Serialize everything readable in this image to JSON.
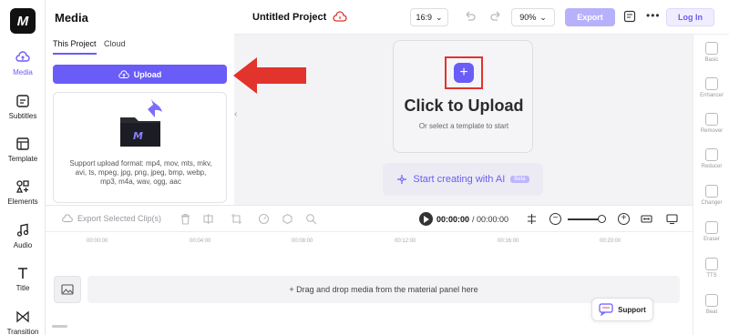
{
  "app": {
    "logo_letter": "M"
  },
  "left_rail": {
    "items": [
      {
        "label": "Media",
        "icon": "media-cloud-icon",
        "active": true
      },
      {
        "label": "Subtitles",
        "icon": "subtitles-icon"
      },
      {
        "label": "Template",
        "icon": "template-icon"
      },
      {
        "label": "Elements",
        "icon": "elements-icon"
      },
      {
        "label": "Audio",
        "icon": "audio-icon"
      },
      {
        "label": "Title",
        "icon": "title-icon"
      },
      {
        "label": "Transition",
        "icon": "transition-icon"
      }
    ]
  },
  "media_panel": {
    "title": "Media",
    "tabs": [
      "This Project",
      "Cloud"
    ],
    "upload_label": "Upload",
    "formats_text": "Support upload format: mp4, mov, mts, mkv, avi, ts, mpeg, jpg, png, jpeg, bmp, webp, mp3, m4a, wav, ogg, aac"
  },
  "topbar": {
    "project_title": "Untitled Project",
    "aspect_ratio": "16:9",
    "zoom": "90%",
    "export_label": "Export",
    "login_label": "Log In"
  },
  "canvas": {
    "plus_symbol": "+",
    "click_to_upload": "Click to Upload",
    "template_hint": "Or select a template to start",
    "ai_label": "Start creating with AI",
    "beta_label": "Beta"
  },
  "tools": [
    "Basic",
    "Enhancer",
    "Remover",
    "Reducer",
    "Changer",
    "Eraser",
    "TTS",
    "Beat"
  ],
  "timeline": {
    "export_clip_label": "Export Selected Clip(s)",
    "current_time": "00:00:00",
    "separator_total": "/ 00:00:00",
    "ruler_ticks": [
      "00:00:00",
      "00:04:00",
      "00:08:00",
      "00:12:00",
      "00:16:00",
      "00:20:00"
    ],
    "drop_text": "+ Drag and drop media from the material panel here"
  },
  "support_label": "Support",
  "colors": {
    "accent": "#6a5cf6",
    "annotation_red": "#e2332c"
  }
}
